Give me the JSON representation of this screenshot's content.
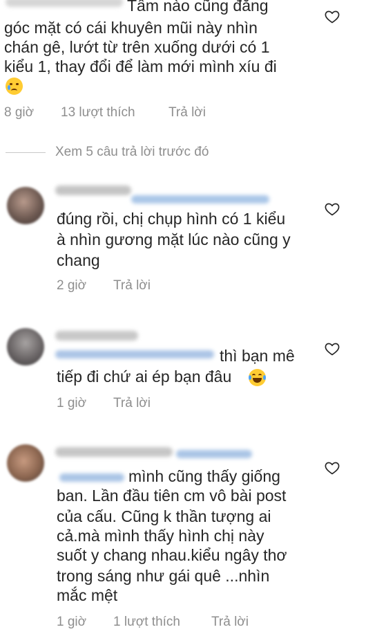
{
  "icons": {
    "heart": "heart-outline-icon",
    "cry": "crying-face-emoji",
    "laugh": "tears-of-joy-emoji"
  },
  "colors": {
    "text": "#262626",
    "meta": "#8e8e8e",
    "divider": "#c7c7c7",
    "heart": "#262626"
  },
  "comment1": {
    "lines": [
      "Tấm nào cũng đăng",
      "góc mặt có cái khuyên mũi này nhìn",
      "chán gê, lướt từ trên xuống dưới có 1",
      "kiểu 1, thay đổi để làm mới mình xíu đi"
    ],
    "time": "8 giờ",
    "likes": "13 lượt thích",
    "reply": "Trả lời"
  },
  "view_replies": "Xem 5 câu trả lời trước đó",
  "reply1": {
    "lines": [
      "đúng rồi, chị chụp hình có 1 kiểu",
      "à nhìn gương mặt lúc nào cũng y",
      "chang"
    ],
    "time": "2 giờ",
    "reply": "Trả lời"
  },
  "reply2": {
    "lines": [
      "thì bạn mê",
      "tiếp đi chứ ai ép bạn đâu"
    ],
    "time": "1 giờ",
    "reply": "Trả lời"
  },
  "reply3": {
    "lines": [
      "mình cũng thấy giống",
      "ban. Lần đầu tiên cm vô bài post",
      "của cấu. Cũng k thần tượng ai",
      "cả.mà mình thấy hình chị này",
      "suốt y chang nhau.kiểu ngây thơ",
      "trong sáng như gái quê ...nhìn",
      "mắc mệt"
    ],
    "time": "1 giờ",
    "likes": "1 lượt thích",
    "reply": "Trả lời"
  }
}
